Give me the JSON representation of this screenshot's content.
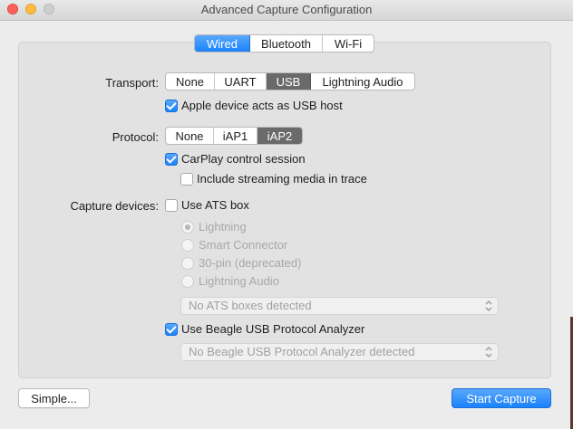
{
  "window": {
    "title": "Advanced Capture Configuration"
  },
  "tabs": [
    "Wired",
    "Bluetooth",
    "Wi-Fi"
  ],
  "transport": {
    "label": "Transport:",
    "options": [
      "None",
      "UART",
      "USB",
      "Lightning Audio"
    ],
    "selected": "USB",
    "usb_host_checkbox": {
      "label": "Apple device acts as USB host",
      "checked": true
    }
  },
  "protocol": {
    "label": "Protocol:",
    "options": [
      "None",
      "iAP1",
      "iAP2"
    ],
    "selected": "iAP2",
    "carplay_checkbox": {
      "label": "CarPlay control session",
      "checked": true
    },
    "streaming_checkbox": {
      "label": "Include streaming media in trace",
      "checked": false
    }
  },
  "capture_devices": {
    "label": "Capture devices:",
    "ats_checkbox": {
      "label": "Use ATS box",
      "checked": false
    },
    "ats_radios": [
      {
        "label": "Lightning",
        "selected": true
      },
      {
        "label": "Smart Connector",
        "selected": false
      },
      {
        "label": "30-pin (deprecated)",
        "selected": false
      },
      {
        "label": "Lightning Audio",
        "selected": false
      }
    ],
    "ats_popup": "No ATS boxes detected",
    "beagle_checkbox": {
      "label": "Use Beagle USB Protocol Analyzer",
      "checked": true
    },
    "beagle_popup": "No Beagle USB Protocol Analyzer detected"
  },
  "buttons": {
    "simple": "Simple...",
    "start": "Start Capture"
  },
  "colors": {
    "accent": "#1a82fb",
    "segment_selected": "#6a6a6a",
    "close": "#fc605c",
    "minimize": "#fdbc40"
  }
}
